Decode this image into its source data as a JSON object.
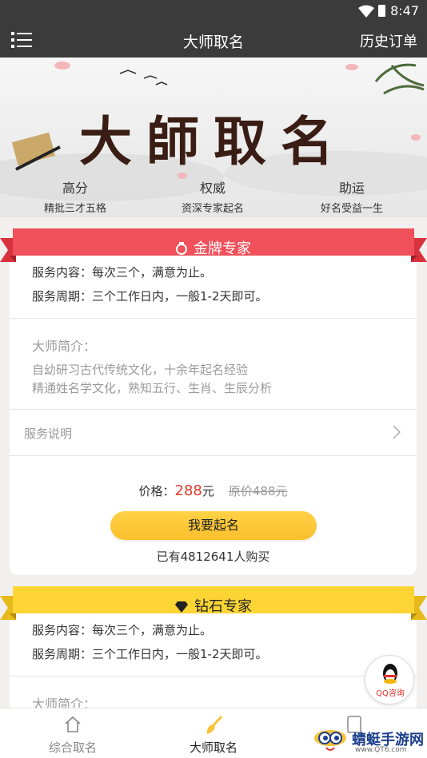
{
  "status": {
    "time": "8:47"
  },
  "header": {
    "title": "大师取名",
    "history_label": "历史订单"
  },
  "banner": {
    "title": "大師取名",
    "columns": [
      {
        "top": "高分",
        "bottom": "精批三才五格"
      },
      {
        "top": "权威",
        "bottom": "资深专家起名"
      },
      {
        "top": "助运",
        "bottom": "好名受益一生"
      }
    ]
  },
  "cards": [
    {
      "ribbon_title": "金牌专家",
      "service_content": "服务内容：每次三个，满意为止。",
      "service_period": "服务周期：三个工作日内，一般1-2天即可。",
      "intro_title": "大师简介：",
      "intro_lines": [
        "自幼研习古代传统文化，十余年起名经验",
        "精通姓名学文化，熟知五行、生肖、生辰分析"
      ],
      "service_note": "服务说明",
      "price_label": "价格：",
      "price": "288",
      "price_unit": "元",
      "original_price": "原价488元",
      "button_label": "我要起名",
      "sold_text": "已有4812641人购买"
    },
    {
      "ribbon_title": "钻石专家",
      "service_content": "服务内容：每次三个，满意为止。",
      "service_period": "服务周期：三个工作日内，一般1-2天即可。",
      "intro_title": "大师简介："
    }
  ],
  "floating": {
    "qq_label": "QQ咨询"
  },
  "tabs": [
    {
      "label": "综合取名",
      "icon": "home-icon",
      "active": false
    },
    {
      "label": "大师取名",
      "icon": "brush-icon",
      "active": true
    },
    {
      "label": "",
      "icon": "book-icon",
      "active": false
    }
  ],
  "watermark": {
    "title": "蜻蜓手游网",
    "url": "www.QT6.com"
  },
  "colors": {
    "header_bg": "#3b3b3b",
    "gold_ribbon": "#f0505a",
    "diamond_ribbon": "#fcd535",
    "price": "#e03b2c",
    "button": "#fcc83a",
    "active_tab": "#222222",
    "inactive_tab": "#888888"
  }
}
